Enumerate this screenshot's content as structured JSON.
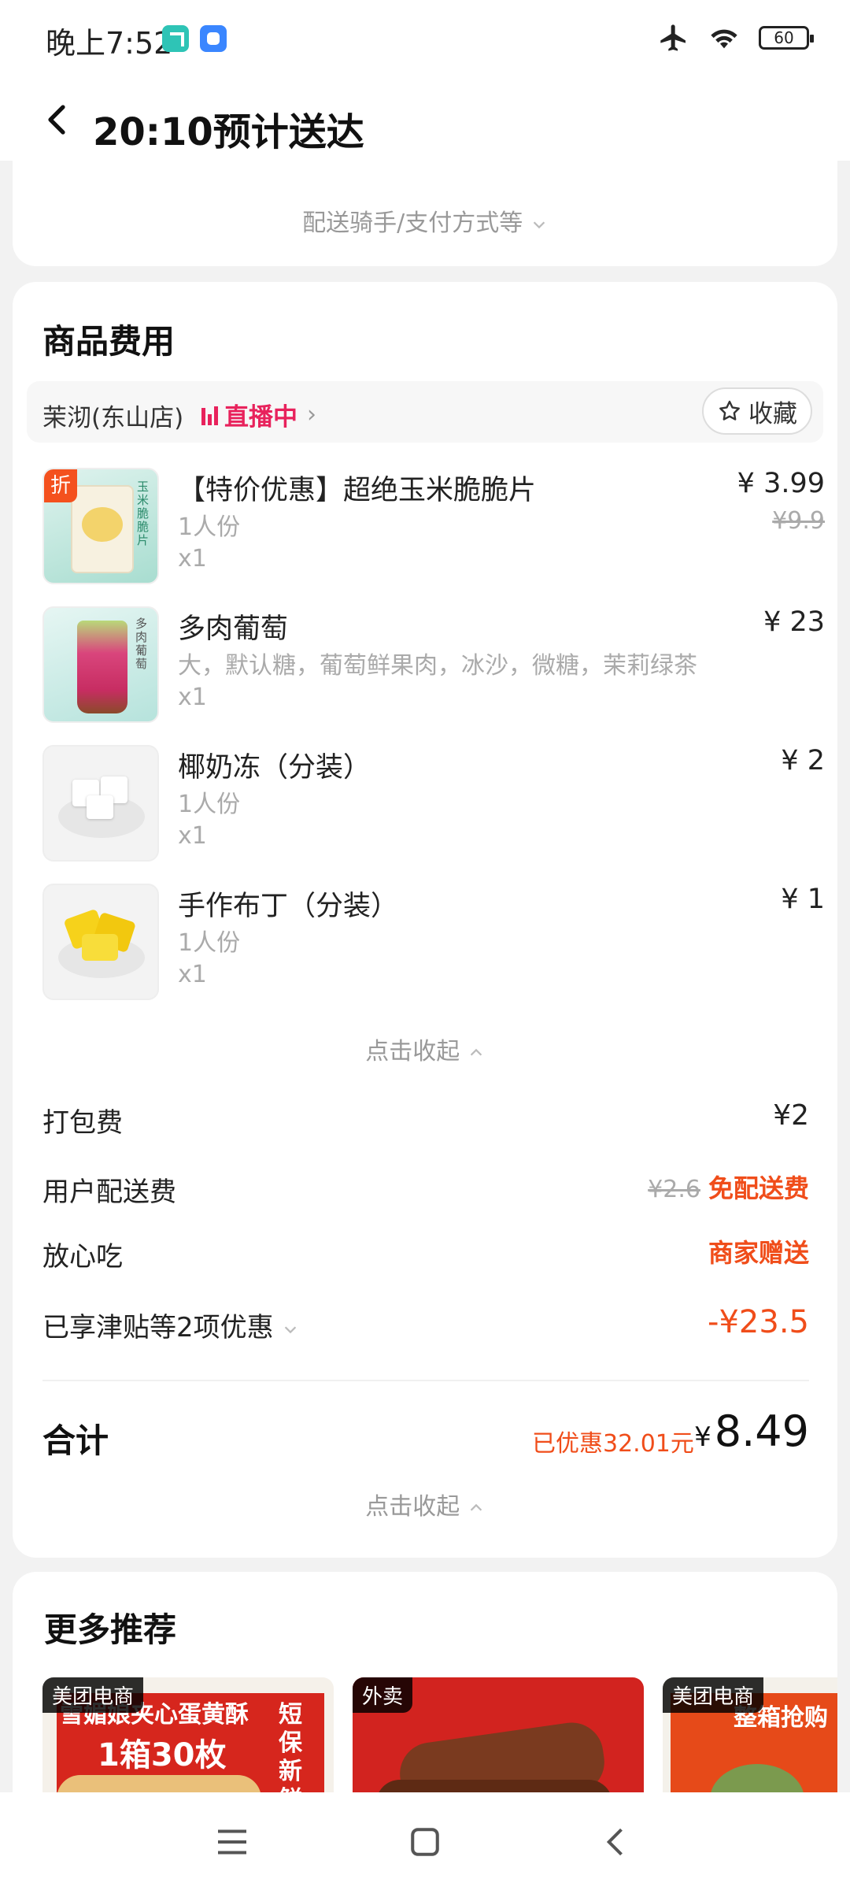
{
  "status_bar": {
    "time": "晚上7:52",
    "battery": "60"
  },
  "header": {
    "title": "20:10预计送达"
  },
  "top_card": {
    "more_label": "配送骑手/支付方式等"
  },
  "fees_section": {
    "title": "商品费用",
    "shop": {
      "name": "茉沏(东山店)",
      "live_label": "直播中",
      "favorite_label": "收藏"
    },
    "items": [
      {
        "name": "【特价优惠】超绝玉米脆脆片",
        "spec": "1人份",
        "qty": "x1",
        "price": "¥ 3.99",
        "original_price": "¥9.9",
        "badge": "折",
        "image_label": "玉米脆脆片"
      },
      {
        "name": "多肉葡萄",
        "spec": "大，默认糖，葡萄鲜果肉，冰沙，微糖，茉莉绿茶",
        "qty": "x1",
        "price": "¥ 23",
        "image_label": "多肉葡萄"
      },
      {
        "name": "椰奶冻（分装）",
        "spec": "1人份",
        "qty": "x1",
        "price": "¥ 2"
      },
      {
        "name": "手作布丁（分装）",
        "spec": "1人份",
        "qty": "x1",
        "price": "¥ 1"
      }
    ],
    "collapse_items_label": "点击收起",
    "packing_fee": {
      "label": "打包费",
      "value": "¥2"
    },
    "delivery_fee": {
      "label": "用户配送费",
      "original": "¥2.6",
      "value": "免配送费"
    },
    "assurance": {
      "label": "放心吃",
      "value": "商家赠送"
    },
    "discounts": {
      "label": "已享津贴等2项优惠",
      "value": "-¥23.5"
    },
    "total": {
      "label": "合计",
      "saved": "已优惠32.01元",
      "currency": "¥",
      "amount": "8.49"
    },
    "collapse_total_label": "点击收起"
  },
  "recommend": {
    "title": "更多推荐",
    "cards": [
      {
        "tag": "美团电商",
        "headline": "雪媚娘夹心蛋黄酥",
        "subline": "1箱30枚",
        "side_text": "短保新鲜"
      },
      {
        "tag": "外卖"
      },
      {
        "tag": "美团电商",
        "headline": "整箱抢购"
      }
    ]
  },
  "colors": {
    "accent_red": "#f04d1a",
    "live_pink": "#e8225c",
    "background": "#f2f2f2"
  }
}
